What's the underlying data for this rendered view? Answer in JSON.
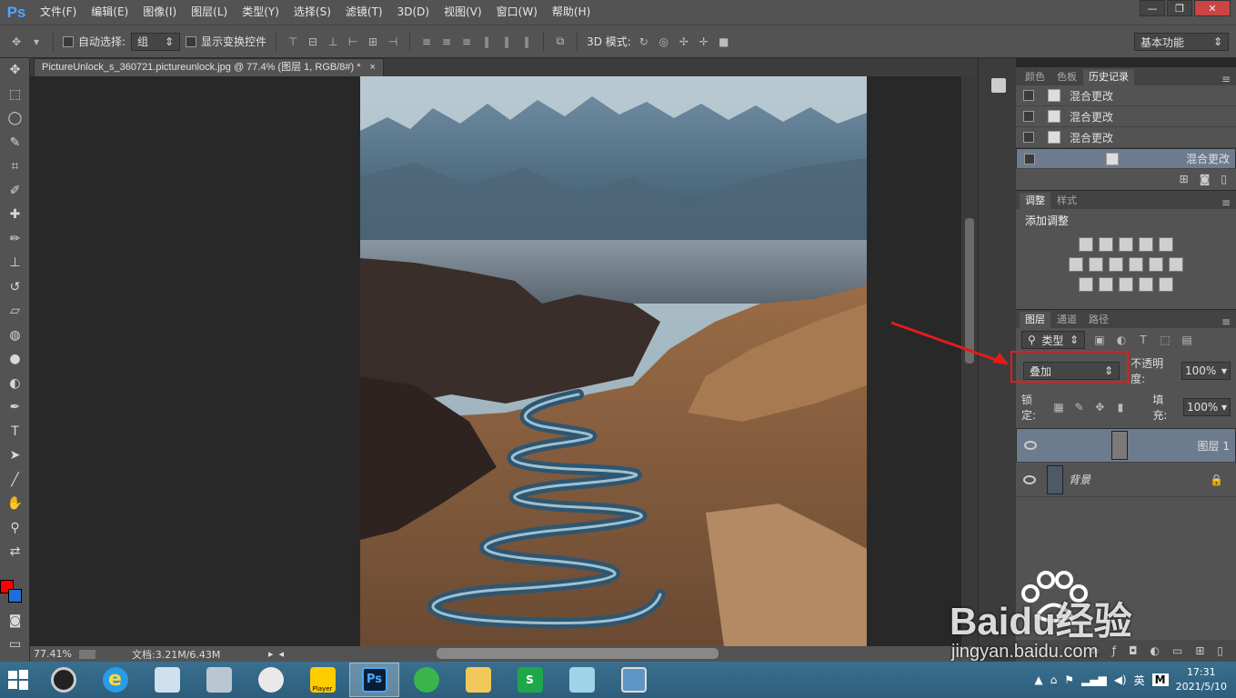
{
  "app": {
    "logo": "Ps"
  },
  "menu": [
    "文件(F)",
    "编辑(E)",
    "图像(I)",
    "图层(L)",
    "类型(Y)",
    "选择(S)",
    "滤镜(T)",
    "3D(D)",
    "视图(V)",
    "窗口(W)",
    "帮助(H)"
  ],
  "window_controls": {
    "minimize": "—",
    "restore": "❐",
    "close": "✕"
  },
  "options": {
    "auto_select_label": "自动选择:",
    "auto_select_value": "组",
    "show_transform_label": "显示变换控件",
    "mode_3d_label": "3D 模式:",
    "workspace": "基本功能"
  },
  "document": {
    "tab_title": "PictureUnlock_s_360721.pictureunlock.jpg @ 77.4% (图层 1, RGB/8#) *",
    "tab_close": "×"
  },
  "status": {
    "zoom": "77.41%",
    "doc_size": "文档:3.21M/6.43M"
  },
  "history_panel": {
    "tabs": [
      "颜色",
      "色板",
      "历史记录"
    ],
    "active_tab": 2,
    "items": [
      "混合更改",
      "混合更改",
      "混合更改",
      "混合更改"
    ]
  },
  "adjust_panel": {
    "tabs": [
      "调整",
      "样式"
    ],
    "title": "添加调整"
  },
  "layers_panel": {
    "tabs": [
      "图层",
      "通道",
      "路径"
    ],
    "filter_kind": "类型",
    "blend_mode": "叠加",
    "opacity_label": "不透明度:",
    "opacity_value": "100%",
    "lock_label": "锁定:",
    "fill_label": "填充:",
    "fill_value": "100%",
    "layers": [
      {
        "name": "图层 1",
        "selected": true
      },
      {
        "name": "背景",
        "selected": false,
        "locked": true
      }
    ]
  },
  "taskbar": {
    "apps": [
      "windows-start",
      "audio-app",
      "ie",
      "calculator",
      "monitor",
      "paint-tool",
      "player",
      "photoshop",
      "sync-app",
      "file-explorer",
      "sheets",
      "notes",
      "image-viewer"
    ],
    "active_app": "photoshop",
    "ps_label": "Ps",
    "player_label": "Player",
    "ime": "英",
    "ime_mode": "M",
    "time": "17:31",
    "date": "2021/5/10"
  },
  "watermark": {
    "brand": "Baidu经验",
    "url": "jingyan.baidu.com"
  },
  "colors": {
    "foreground": "#ff0000",
    "background": "#1e6fd9",
    "highlight": "#e21c1c"
  }
}
